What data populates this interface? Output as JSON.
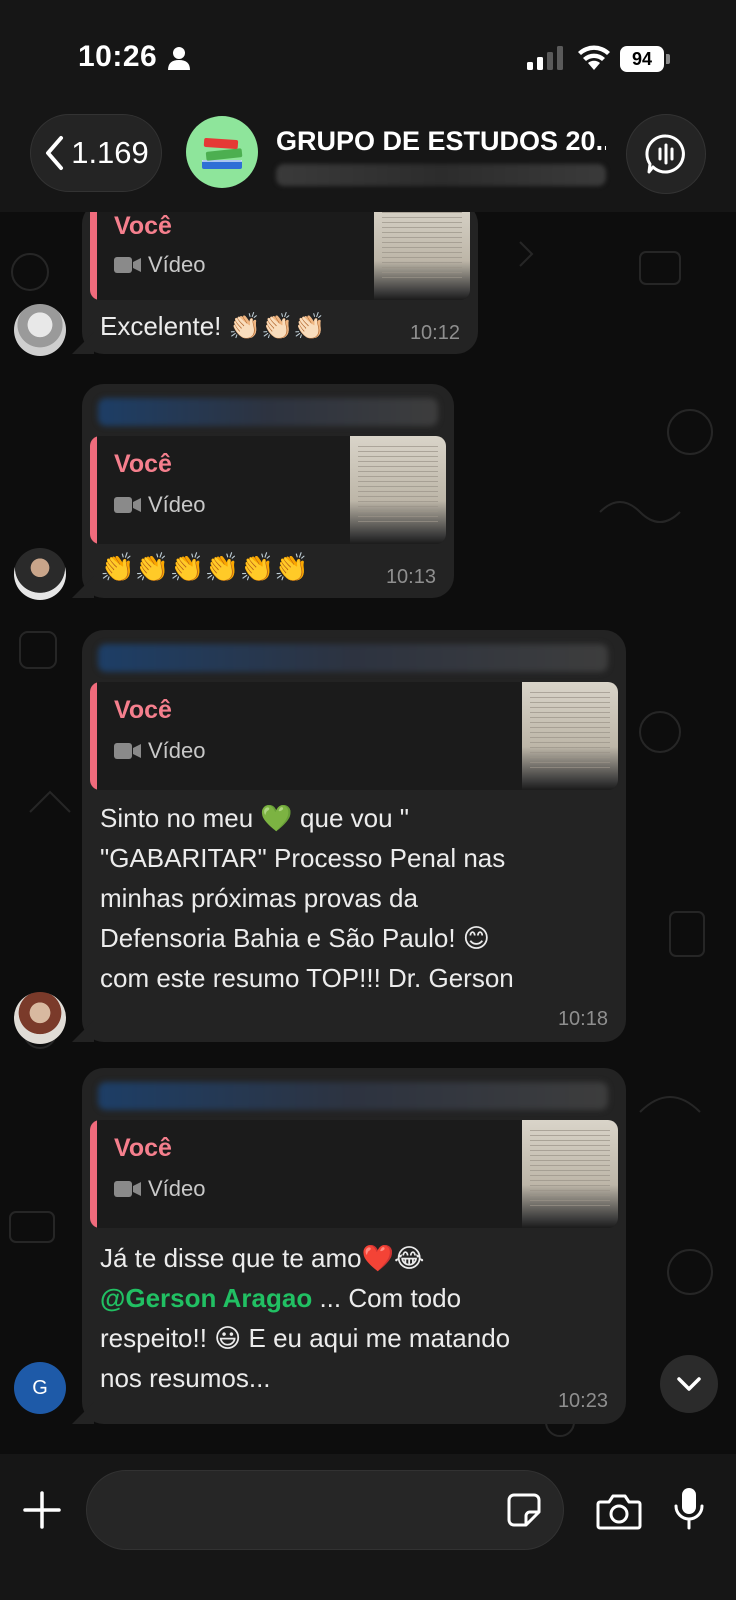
{
  "status_bar": {
    "time": "10:26",
    "battery": "94"
  },
  "header": {
    "back_count": "1.169",
    "group_title": "GRUPO DE ESTUDOS 20...",
    "group_avatar_icon": "books-emoji"
  },
  "messages": [
    {
      "quote": {
        "author": "Você",
        "type": "Vídeo"
      },
      "text": "Excelente! 👏🏻👏🏻👏🏻",
      "time": "10:12"
    },
    {
      "quote": {
        "author": "Você",
        "type": "Vídeo"
      },
      "text": "👏👏👏👏👏👏",
      "time": "10:13"
    },
    {
      "quote": {
        "author": "Você",
        "type": "Vídeo"
      },
      "text_lines": [
        "Sinto   no meu  💚  que vou \"",
        "\"GABARITAR\"  Processo Penal nas",
        "minhas próximas provas da",
        "Defensoria Bahia e São Paulo! 😊",
        "com este resumo TOP!!! Dr. Gerson"
      ],
      "time": "10:18"
    },
    {
      "quote": {
        "author": "Você",
        "type": "Vídeo"
      },
      "line1": "Já te disse que te amo❤️😂",
      "mention": "@Gerson Aragao",
      "line2_rest": " ... Com todo",
      "line3": "respeito!! 😃  E eu aqui me matando",
      "line4": "nos resumos...",
      "time": "10:23",
      "avatar_letter": "G"
    }
  ],
  "colors": {
    "accent_green": "#21c063",
    "quote_pink": "#f57f8d",
    "bubble": "#232323"
  }
}
